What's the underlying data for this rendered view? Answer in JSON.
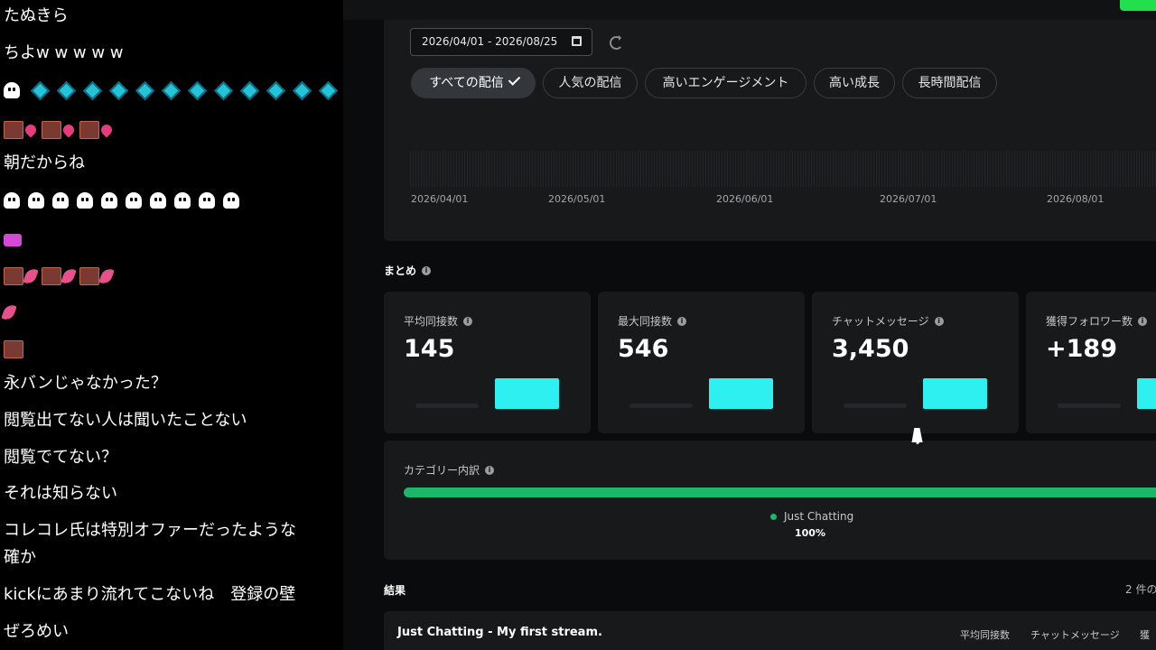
{
  "chat": {
    "messages": [
      "たぬきら",
      "ちよw w w w w",
      "朝だからね",
      "永バンじゃなかった？",
      "閲覧出てない人は聞いたことない",
      "閲覧でてない？",
      "それは知らない",
      "コレコレ氏は特別オファーだったような",
      "確か",
      "kickにあまり流れてこないね　登録の壁",
      "ぜろめい"
    ]
  },
  "filters": {
    "date_range": "2026/04/01 - 2026/08/25",
    "chips": [
      "すべての配信",
      "人気の配信",
      "高いエンゲージメント",
      "高い成長",
      "長時間配信"
    ],
    "timeline_labels": [
      "2026/04/01",
      "2026/05/01",
      "2026/06/01",
      "2026/07/01",
      "2026/08/01"
    ]
  },
  "summary": {
    "title": "まとめ",
    "stats": [
      {
        "label": "平均同接数",
        "value": "145"
      },
      {
        "label": "最大同接数",
        "value": "546"
      },
      {
        "label": "チャットメッセージ",
        "value": "3,450"
      },
      {
        "label": "獲得フォロワー数",
        "value": "+189"
      }
    ]
  },
  "category": {
    "title": "カテゴリー内訳",
    "name": "Just Chatting",
    "percent": "100%"
  },
  "results": {
    "title": "結果",
    "count": "2 件の",
    "first_title": "Just Chatting - My first stream.",
    "columns": [
      "平均同接数",
      "チャットメッセージ",
      "獲"
    ]
  },
  "colors": {
    "accent_cyan": "#2ef0f0",
    "category_green": "#1bb86b",
    "status_green": "#22e04b"
  }
}
